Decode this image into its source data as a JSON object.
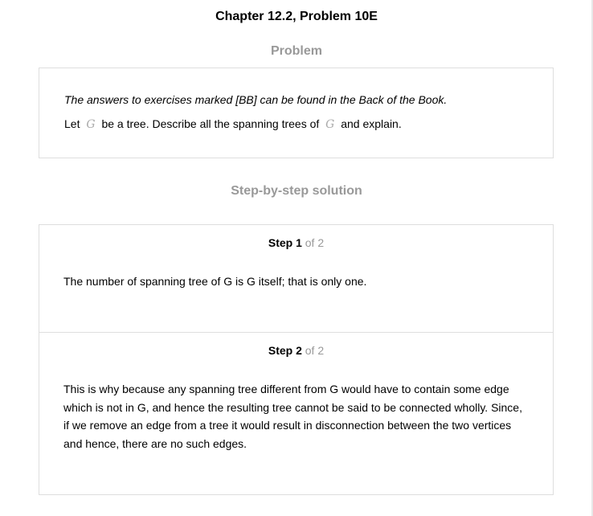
{
  "title": "Chapter 12.2, Problem 10E",
  "problem": {
    "heading": "Problem",
    "intro": "The answers to exercises marked [BB] can be found in the Back of the Book.",
    "statement_part1": "Let",
    "symbol": "G",
    "statement_part2": "be a tree. Describe all the spanning trees of",
    "statement_part3": "and explain."
  },
  "solution": {
    "heading": "Step-by-step solution",
    "steps": [
      {
        "label": "Step 1",
        "of": "of 2",
        "text": "The number of spanning tree of G is G itself; that is only one."
      },
      {
        "label": "Step 2",
        "of": "of 2",
        "text": "This is why because any spanning tree different from G would have to contain some edge which is not in G, and hence the resulting tree cannot be said to be connected wholly. Since, if we remove an edge from a tree it would result in disconnection between the two vertices and hence, there are no such edges."
      }
    ]
  }
}
